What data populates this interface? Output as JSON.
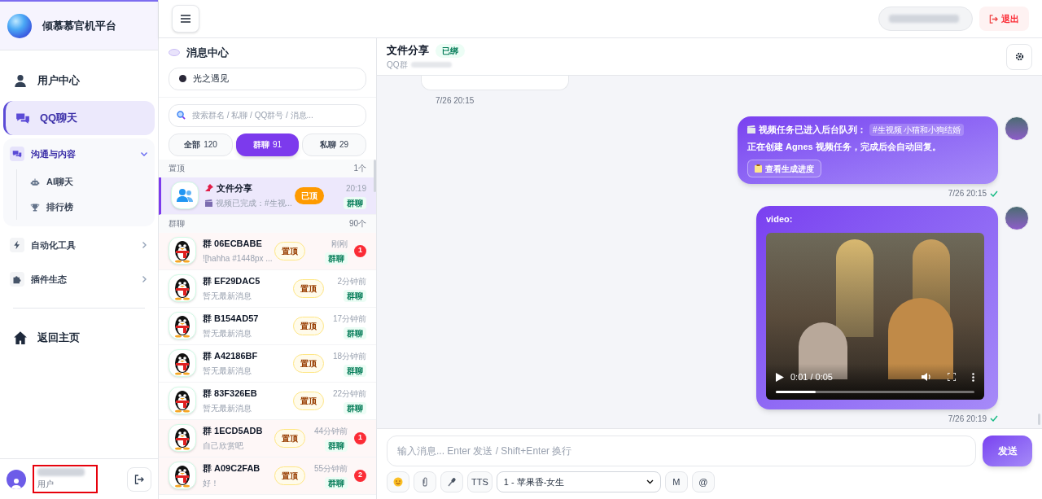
{
  "brand": {
    "title": "倾慕慕官机平台"
  },
  "nav": [
    {
      "label": "用户中心",
      "kind": "item",
      "selected": false
    },
    {
      "label": "QQ聊天",
      "kind": "item",
      "selected": true
    },
    {
      "label": "沟通与内容",
      "kind": "group",
      "expanded": true,
      "children": [
        {
          "label": "AI聊天"
        },
        {
          "label": "排行榜"
        }
      ]
    },
    {
      "label": "自动化工具",
      "kind": "group",
      "expanded": false
    },
    {
      "label": "插件生态",
      "kind": "group",
      "expanded": false
    }
  ],
  "nav_bottom": [
    {
      "label": "返回主页",
      "selected": false
    }
  ],
  "user": {
    "role": "用户"
  },
  "topbar": {
    "logout": "退出"
  },
  "messages_panel": {
    "title": "消息中心",
    "account": "光之遇见",
    "search_placeholder": "搜索群名 / 私聊 / QQ群号 / 消息...",
    "tabs": [
      {
        "label": "全部",
        "count": "120",
        "selected": false
      },
      {
        "label": "群聊",
        "count": "91",
        "selected": true
      },
      {
        "label": "私聊",
        "count": "29",
        "selected": false
      }
    ],
    "sections": [
      {
        "title": "置顶",
        "count": "1个",
        "rows": [
          {
            "kind": "pinned",
            "name": "文件分享",
            "preview": "视频已完成：#生视...",
            "time": "20:19",
            "pin": "已顶",
            "tag": "群聊",
            "selected": true
          }
        ]
      },
      {
        "title": "群聊",
        "count": "90个",
        "rows": [
          {
            "kind": "group",
            "name": "群 06ECBABE",
            "preview": "![hahha #1448px ...",
            "time": "刚刚",
            "pin": "置顶",
            "tag": "群聊",
            "unread": "1",
            "selected": false
          },
          {
            "kind": "group",
            "name": "群 EF29DAC5",
            "preview": "暂无最新消息",
            "time": "2分钟前",
            "pin": "置顶",
            "tag": "群聊",
            "selected": false
          },
          {
            "kind": "group",
            "name": "群 B154AD57",
            "preview": "暂无最新消息",
            "time": "17分钟前",
            "pin": "置顶",
            "tag": "群聊",
            "selected": false
          },
          {
            "kind": "group",
            "name": "群 A42186BF",
            "preview": "暂无最新消息",
            "time": "18分钟前",
            "pin": "置顶",
            "tag": "群聊",
            "selected": false
          },
          {
            "kind": "group",
            "name": "群 83F326EB",
            "preview": "暂无最新消息",
            "time": "22分钟前",
            "pin": "置顶",
            "tag": "群聊",
            "selected": false
          },
          {
            "kind": "group",
            "name": "群 1ECD5ADB",
            "preview": "自己欣赏吧",
            "time": "44分钟前",
            "pin": "置顶",
            "tag": "群聊",
            "unread": "1",
            "selected": false
          },
          {
            "kind": "group",
            "name": "群 A09C2FAB",
            "preview": "好！",
            "time": "55分钟前",
            "pin": "置顶",
            "tag": "群聊",
            "unread": "2",
            "selected": false
          }
        ]
      }
    ]
  },
  "chat": {
    "title": "文件分享",
    "badge": "已绑",
    "subtitle": "QQ群",
    "messages": [
      {
        "kind": "partial",
        "time": "7/26 20:15"
      },
      {
        "kind": "card",
        "title": "视频任务已进入后台队列：",
        "tag": "#生视频  小猫和小狗结婚",
        "body": "正在创建 Agnes 视频任务，完成后会自动回复。",
        "button": "查看生成进度",
        "time": "7/26 20:15",
        "read": true
      },
      {
        "kind": "video",
        "label": "video:",
        "position": "0:01 / 0:05",
        "level": 0.2,
        "time": "7/26 20:19",
        "read": true
      }
    ]
  },
  "composer": {
    "placeholder": "输入消息... Enter 发送 / Shift+Enter 换行",
    "send": "发送",
    "buttons_before": [
      "TTS"
    ],
    "voice": "1 - 苹果香-女生",
    "buttons_after": [
      "M",
      "@"
    ]
  }
}
